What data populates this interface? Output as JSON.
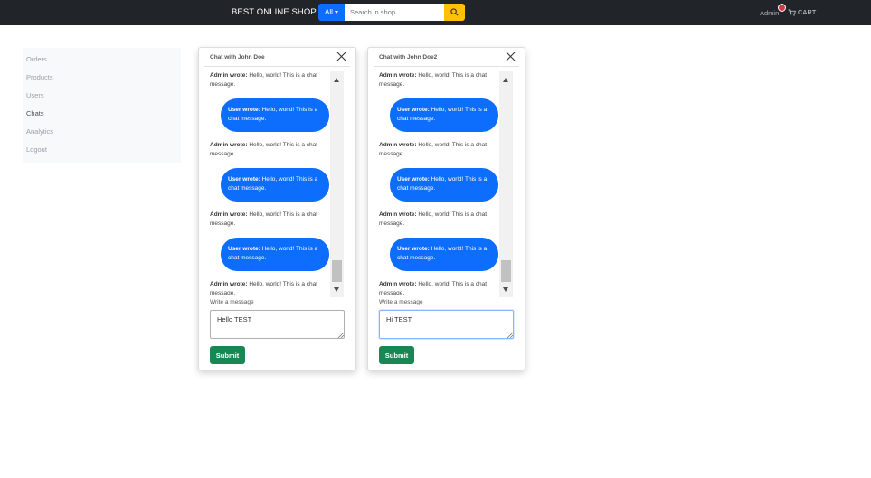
{
  "navbar": {
    "brand": "BEST ONLINE SHOP",
    "category_button": "All",
    "search_placeholder": "Search in shop ...",
    "admin_label": "Admin",
    "cart_label": "CART"
  },
  "sidebar": {
    "items": [
      {
        "label": "Orders"
      },
      {
        "label": "Products"
      },
      {
        "label": "Users"
      },
      {
        "label": "Chats"
      },
      {
        "label": "Analytics"
      },
      {
        "label": "Logout"
      }
    ],
    "active": "Chats"
  },
  "chats": [
    {
      "title": "Chat with John Doe",
      "messages": {
        "admin_prefix": "Admin wrote:",
        "admin_text": "Hello, world! This is a chat message.",
        "user_prefix": "User wrote:",
        "user_text": "Hello, world! This is a chat message."
      },
      "input_label": "Write a message",
      "input_value": "Hello TEST",
      "submit_label": "Submit"
    },
    {
      "title": "Chat with John Doe2",
      "messages": {
        "admin_prefix": "Admin wrote:",
        "admin_text": "Hello, world! This is a chat message.",
        "user_prefix": "User wrote:",
        "user_text": "Hello, world! This is a chat message."
      },
      "input_label": "Write a message",
      "input_value": "Hi TEST",
      "submit_label": "Submit"
    }
  ],
  "colors": {
    "navbar": "#212529",
    "primary": "#0d6efd",
    "warning": "#ffc107",
    "success": "#198754",
    "danger": "#dc3545"
  },
  "icons": [
    "search-icon",
    "cart-icon",
    "close-icon",
    "chevron-down-icon"
  ]
}
